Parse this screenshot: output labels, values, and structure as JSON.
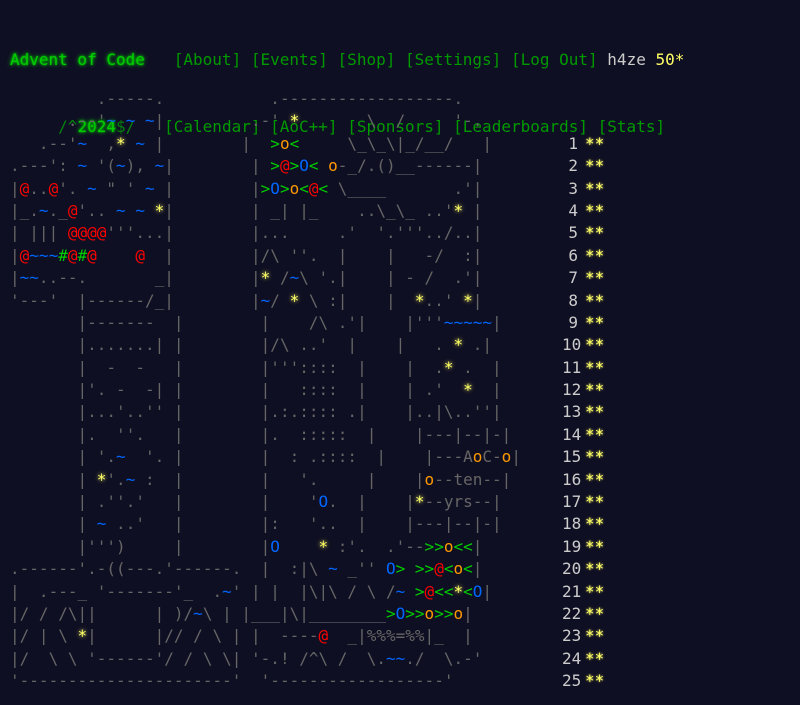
{
  "header": {
    "title": "Advent of Code",
    "year_prefix": "/^",
    "year": "2024",
    "year_suffix": "$/",
    "nav_top": [
      "[About]",
      "[Events]",
      "[Shop]",
      "[Settings]",
      "[Log Out]"
    ],
    "nav_bottom": [
      "[Calendar]",
      "[AoC++]",
      "[Sponsors]",
      "[Leaderboards]",
      "[Stats]"
    ],
    "user": "h4ze",
    "score": "50*"
  },
  "calendar": {
    "preamble": [
      "         .-----.           .------------------.",
      "      .--'~ ~ ~|         .-' *       \\  /     '-."
    ],
    "days": [
      {
        "day": "1",
        "stars": "**",
        "art": "   .--'~  ,* ~ |        |  >o<     \\_\\_\\|_/__/   |"
      },
      {
        "day": "2",
        "stars": "**",
        "art": ".---': ~ '(~), ~|        | >@>O< o-_/.()__------|"
      },
      {
        "day": "3",
        "stars": "**",
        "art": "|@..@'. ~ \" ' ~ |        |>O>o<@< \\____       .'|"
      },
      {
        "day": "4",
        "stars": "**",
        "art": "|_.~._@'.. ~ ~ *|        | _| |_    ..\\_\\_ ..'* |"
      },
      {
        "day": "5",
        "stars": "**",
        "art": "| ||| @@@@'''...|        |...     .'  '.'''../..|"
      },
      {
        "day": "6",
        "stars": "**",
        "art": "|@~~~#@#@    @  |        |/\\ ''.  |    |   -/  :|"
      },
      {
        "day": "7",
        "stars": "**",
        "art": "|~~..--.       _|        |* /~\\ '.|    | - /  .'|"
      },
      {
        "day": "8",
        "stars": "**",
        "art": "'---'  |------/_|        |~/ * \\ :|    |  *..' *|"
      },
      {
        "day": "9",
        "stars": "**",
        "art": "       |-------  |        |    /\\ .'|    |'''~~~~~|"
      },
      {
        "day": "10",
        "stars": "**",
        "art": "       |.......| |        |/\\ ..'  |    |   . * .|"
      },
      {
        "day": "11",
        "stars": "**",
        "art": "       |  -  -   |        |'''::::  |    |  .* .  |"
      },
      {
        "day": "12",
        "stars": "**",
        "art": "       |'. -  -| |        |   ::::  |    | .'  *  |"
      },
      {
        "day": "13",
        "stars": "**",
        "art": "       |...'..'' |        |.:.:::: .|    |..|\\..''|"
      },
      {
        "day": "14",
        "stars": "**",
        "art": "       |.  ''.   |        |.  :::::  |    |---|--|-|"
      },
      {
        "day": "15",
        "stars": "**",
        "art": "       | '.~  '. |        |  : .::::  |    |---AoC-o|"
      },
      {
        "day": "16",
        "stars": "**",
        "art": "       | *'.~ :  |        |   '.     |    |o--ten--|"
      },
      {
        "day": "17",
        "stars": "**",
        "art": "       | .''.'   |        |    'O.  |    |*--yrs--|"
      },
      {
        "day": "18",
        "stars": "**",
        "art": "       | ~ ..'   |        |:   '..  |    |---|--|-|"
      },
      {
        "day": "19",
        "stars": "**",
        "art": "       |''')     |        |O    * :'.  .'-->>o<<|"
      },
      {
        "day": "20",
        "stars": "**",
        "art": ".------'.-((---.'------.  |  :|\\ ~ _'' O> >>@<o<|"
      },
      {
        "day": "21",
        "stars": "**",
        "art": "|  .---_ '-------'_  .~' | |  |\\|\\ / \\ /~ >@<<*<O|"
      },
      {
        "day": "22",
        "stars": "**",
        "art": "|/ / /\\||      | )/~\\ | |___|\\|________>O>>o>>o|"
      },
      {
        "day": "23",
        "stars": "**",
        "art": "|/ | \\ *|      |// / \\ | |  ----@  _|%%%=%%|_  |"
      },
      {
        "day": "24",
        "stars": "**",
        "art": "|/  \\ \\ '------'/ / \\ \\| '-.! /^\\ /  \\.~~./  \\.-'"
      },
      {
        "day": "25",
        "stars": "**",
        "art": "'----------------------'  '------------------'"
      }
    ]
  }
}
